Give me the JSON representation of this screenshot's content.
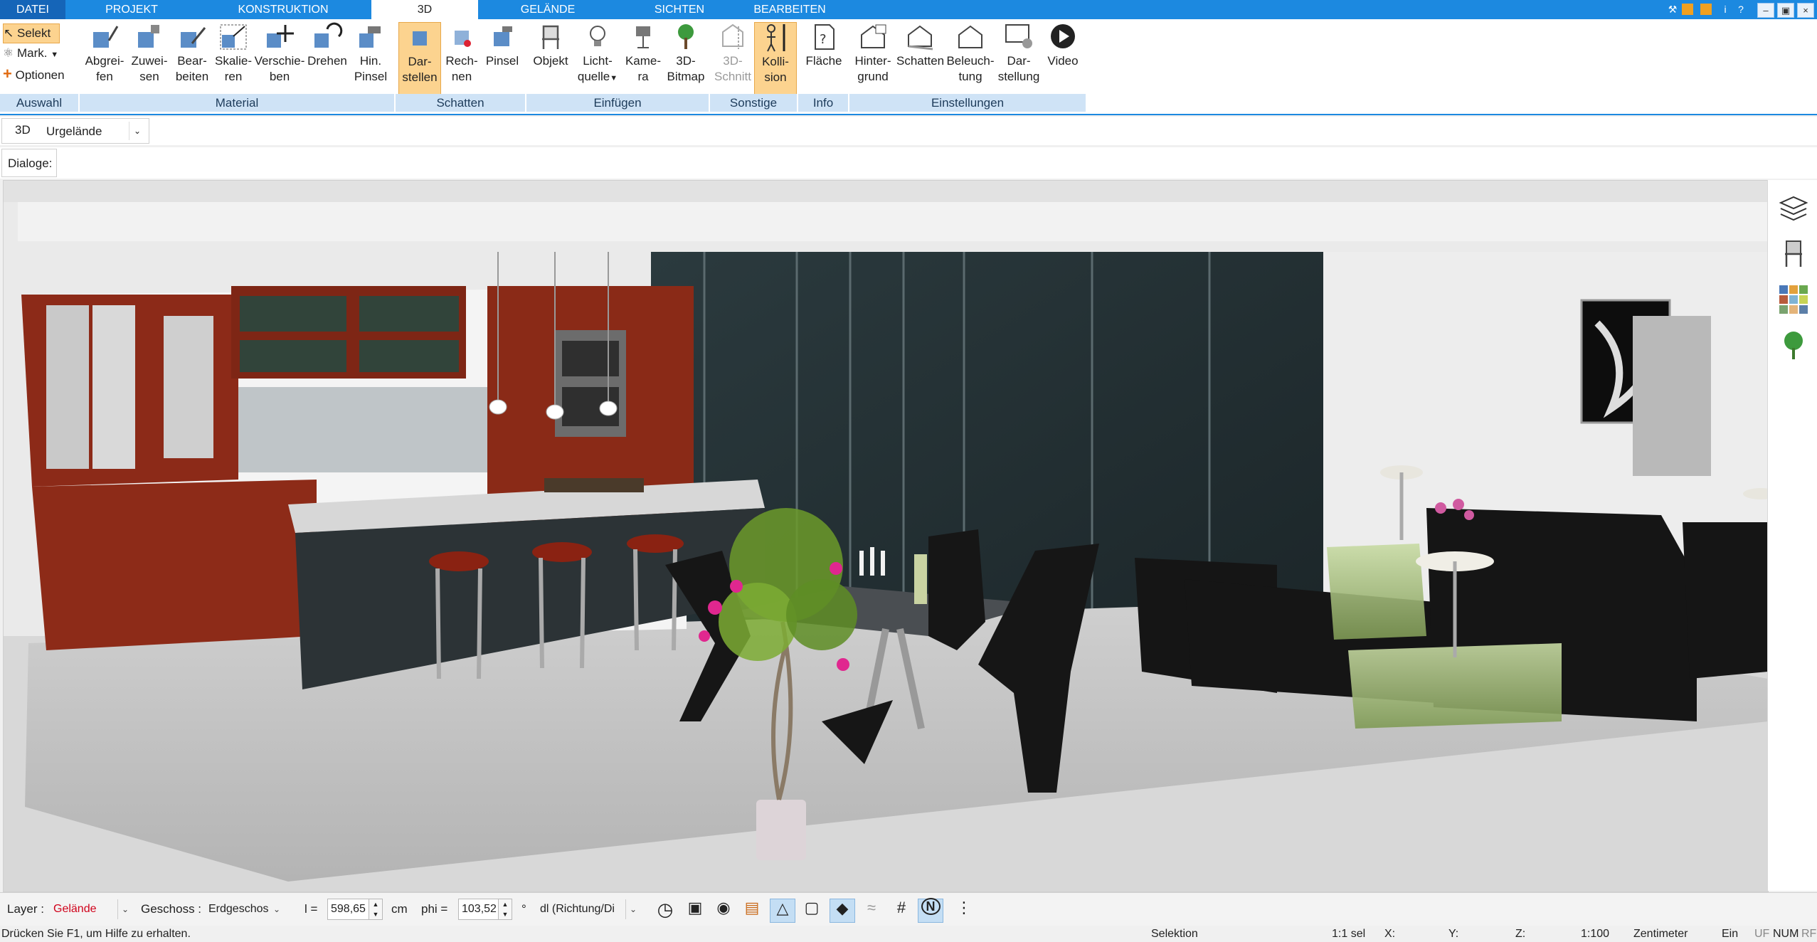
{
  "tabs": {
    "datei": "DATEI",
    "projekt": "PROJEKT",
    "konstruktion": "KONSTRUKTION",
    "drei_d": "3D",
    "gelaende": "GELÄNDE",
    "sichten": "SICHTEN",
    "bearbeiten": "BEARBEITEN"
  },
  "ribbon": {
    "auswahl": {
      "selekt": "Selekt",
      "mark": "Mark.",
      "optionen": "Optionen",
      "group": "Auswahl"
    },
    "material": {
      "group": "Material",
      "b1": [
        "Abgrei-",
        "fen"
      ],
      "b2": [
        "Zuwei-",
        "sen"
      ],
      "b3": [
        "Bear-",
        "beiten"
      ],
      "b4": [
        "Skalie-",
        "ren"
      ],
      "b5": [
        "Verschie-",
        "ben"
      ],
      "b6": [
        "Drehen",
        ""
      ],
      "b7": [
        "Hin.",
        "Pinsel"
      ]
    },
    "schatten": {
      "group": "Schatten",
      "b1": [
        "Dar-",
        "stellen"
      ],
      "b2": [
        "Rech-",
        "nen"
      ],
      "b3": [
        "Pinsel",
        ""
      ]
    },
    "einfuegen": {
      "group": "Einfügen",
      "b1": [
        "Objekt",
        ""
      ],
      "b2": [
        "Licht-",
        "quelle"
      ],
      "b3": [
        "Kame-",
        "ra"
      ],
      "b4": [
        "3D-",
        "Bitmap"
      ]
    },
    "sonstige": {
      "group": "Sonstige",
      "b1": [
        "3D-",
        "Schnitt"
      ],
      "b2": [
        "Kolli-",
        "sion"
      ]
    },
    "info": {
      "group": "Info",
      "b1": [
        "Fläche",
        ""
      ]
    },
    "einstellungen": {
      "group": "Einstellungen",
      "b1": [
        "Hinter-",
        "grund"
      ],
      "b2": [
        "Schatten",
        ""
      ],
      "b3": [
        "Beleuch-",
        "tung"
      ],
      "b4": [
        "Dar-",
        "stellung"
      ],
      "b5": [
        "Video",
        ""
      ]
    }
  },
  "viewbar": {
    "label": "3D",
    "value": "Urgelände"
  },
  "dialogbar": {
    "label": "Dialoge:"
  },
  "params": {
    "layer_label": "Layer :",
    "layer_value": "Gelände",
    "geschoss_label": "Geschoss :",
    "geschoss_value": "Erdgeschos",
    "l_label": "l =",
    "l_value": "598,65",
    "l_unit": "cm",
    "phi_label": "phi =",
    "phi_value": "103,52",
    "phi_unit": "°",
    "dl_value": "dl (Richtung/Di"
  },
  "status": {
    "help": "Drücken Sie F1, um Hilfe zu erhalten.",
    "mode": "Selektion",
    "scale_sel": "1:1 sel",
    "x": "X:",
    "y": "Y:",
    "z": "Z:",
    "scale": "1:100",
    "unit": "Zentimeter",
    "ein": "Ein",
    "uf": "UF",
    "num": "NUM",
    "rf": "RF"
  },
  "colors": {
    "accent": "#1c89e0",
    "group_bg": "#cfe3f6",
    "highlight": "#fcd38f",
    "layer_value": "#d0021b"
  },
  "icons": [
    "layers-icon",
    "chair-icon",
    "material-palette-icon",
    "tree-icon",
    "clock-icon",
    "video-play-icon"
  ]
}
